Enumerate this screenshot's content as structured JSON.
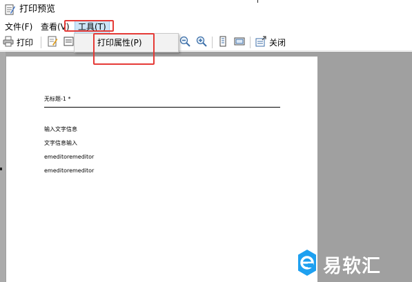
{
  "window": {
    "title": "打印预览"
  },
  "menu": {
    "file": "文件(F)",
    "view": "查看(V)",
    "tools": "工具(T)"
  },
  "toolbar": {
    "print_label": "打印",
    "close_label": "关闭"
  },
  "dropdown": {
    "items": [
      "打印属性(P)"
    ]
  },
  "document": {
    "header": "无标题-1 *",
    "lines": [
      "输入文字信息",
      "文字信息输入",
      "emeditoremeditor",
      "emeditoremeditor"
    ]
  },
  "watermark": {
    "text": "易软汇"
  },
  "colors": {
    "highlight_border": "#e53935",
    "preview_background": "#a0a0a0",
    "menu_active": "#cce4f7",
    "watermark_logo": "#1ea0f0"
  }
}
